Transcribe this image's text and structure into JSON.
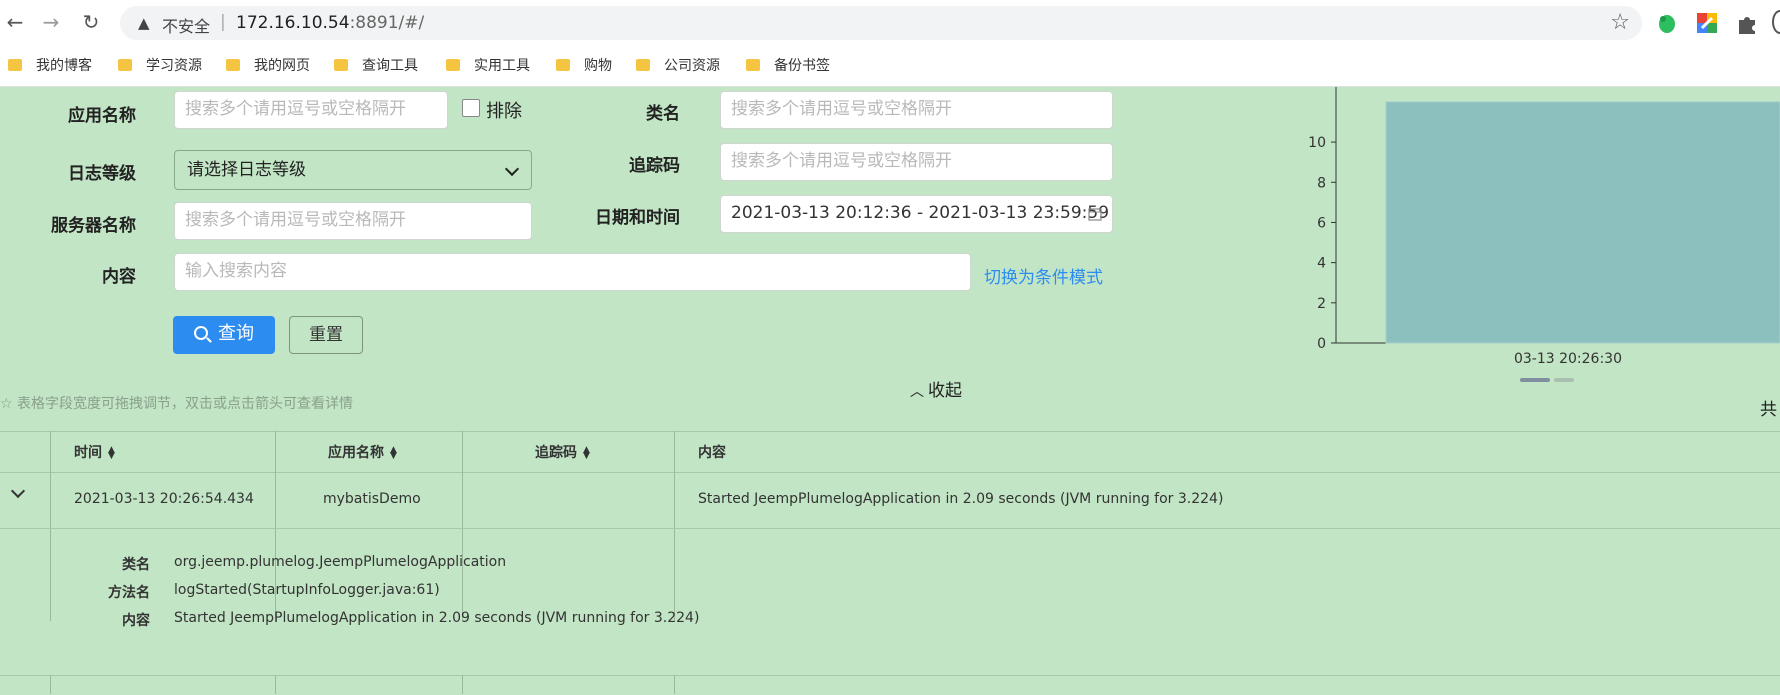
{
  "browser": {
    "insecure_label": "不安全",
    "url_host": "172.16.10.54",
    "url_rest": ":8891/#/"
  },
  "bookmarks": [
    "我的博客",
    "学习资源",
    "我的网页",
    "查询工具",
    "实用工具",
    "购物",
    "公司资源",
    "备份书签"
  ],
  "form": {
    "app_name_label": "应用名称",
    "app_name_placeholder": "搜索多个请用逗号或空格隔开",
    "exclude_label": "排除",
    "class_label": "类名",
    "class_placeholder": "搜索多个请用逗号或空格隔开",
    "level_label": "日志等级",
    "level_value": "请选择日志等级",
    "trace_label": "追踪码",
    "trace_placeholder": "搜索多个请用逗号或空格隔开",
    "server_label": "服务器名称",
    "server_placeholder": "搜索多个请用逗号或空格隔开",
    "datetime_label": "日期和时间",
    "datetime_value": "2021-03-13 20:12:36 - 2021-03-13 23:59:59",
    "content_label": "内容",
    "content_placeholder": "输入搜索内容",
    "switch_link": "切换为条件模式",
    "query_button": "查询",
    "reset_button": "重置",
    "collapse_label": "收起",
    "hint": "☆ 表格字段宽度可拖拽调节，双击或点击箭头可查看详情",
    "total_prefix": "共"
  },
  "chart_data": {
    "type": "bar",
    "categories": [
      "03-13 20:26:30"
    ],
    "values": [
      12
    ],
    "ylim": [
      0,
      11
    ],
    "yticks": [
      "0",
      "2",
      "4",
      "6",
      "8",
      "10"
    ],
    "colors": {
      "bar": "#8cc0be"
    }
  },
  "table": {
    "columns": [
      "时间",
      "应用名称",
      "追踪码",
      "内容"
    ],
    "rows": [
      {
        "time": "2021-03-13 20:26:54.434",
        "app": "mybatisDemo",
        "trace": "",
        "content": "Started JeempPlumelogApplication in 2.09 seconds (JVM running for 3.224)"
      }
    ],
    "detail": {
      "class_label": "类名",
      "class_value": "org.jeemp.plumelog.JeempPlumelogApplication",
      "method_label": "方法名",
      "method_value": "logStarted(StartupInfoLogger.java:61)",
      "content_label": "内容",
      "content_value": "Started JeempPlumelogApplication in 2.09 seconds (JVM running for 3.224)"
    }
  }
}
